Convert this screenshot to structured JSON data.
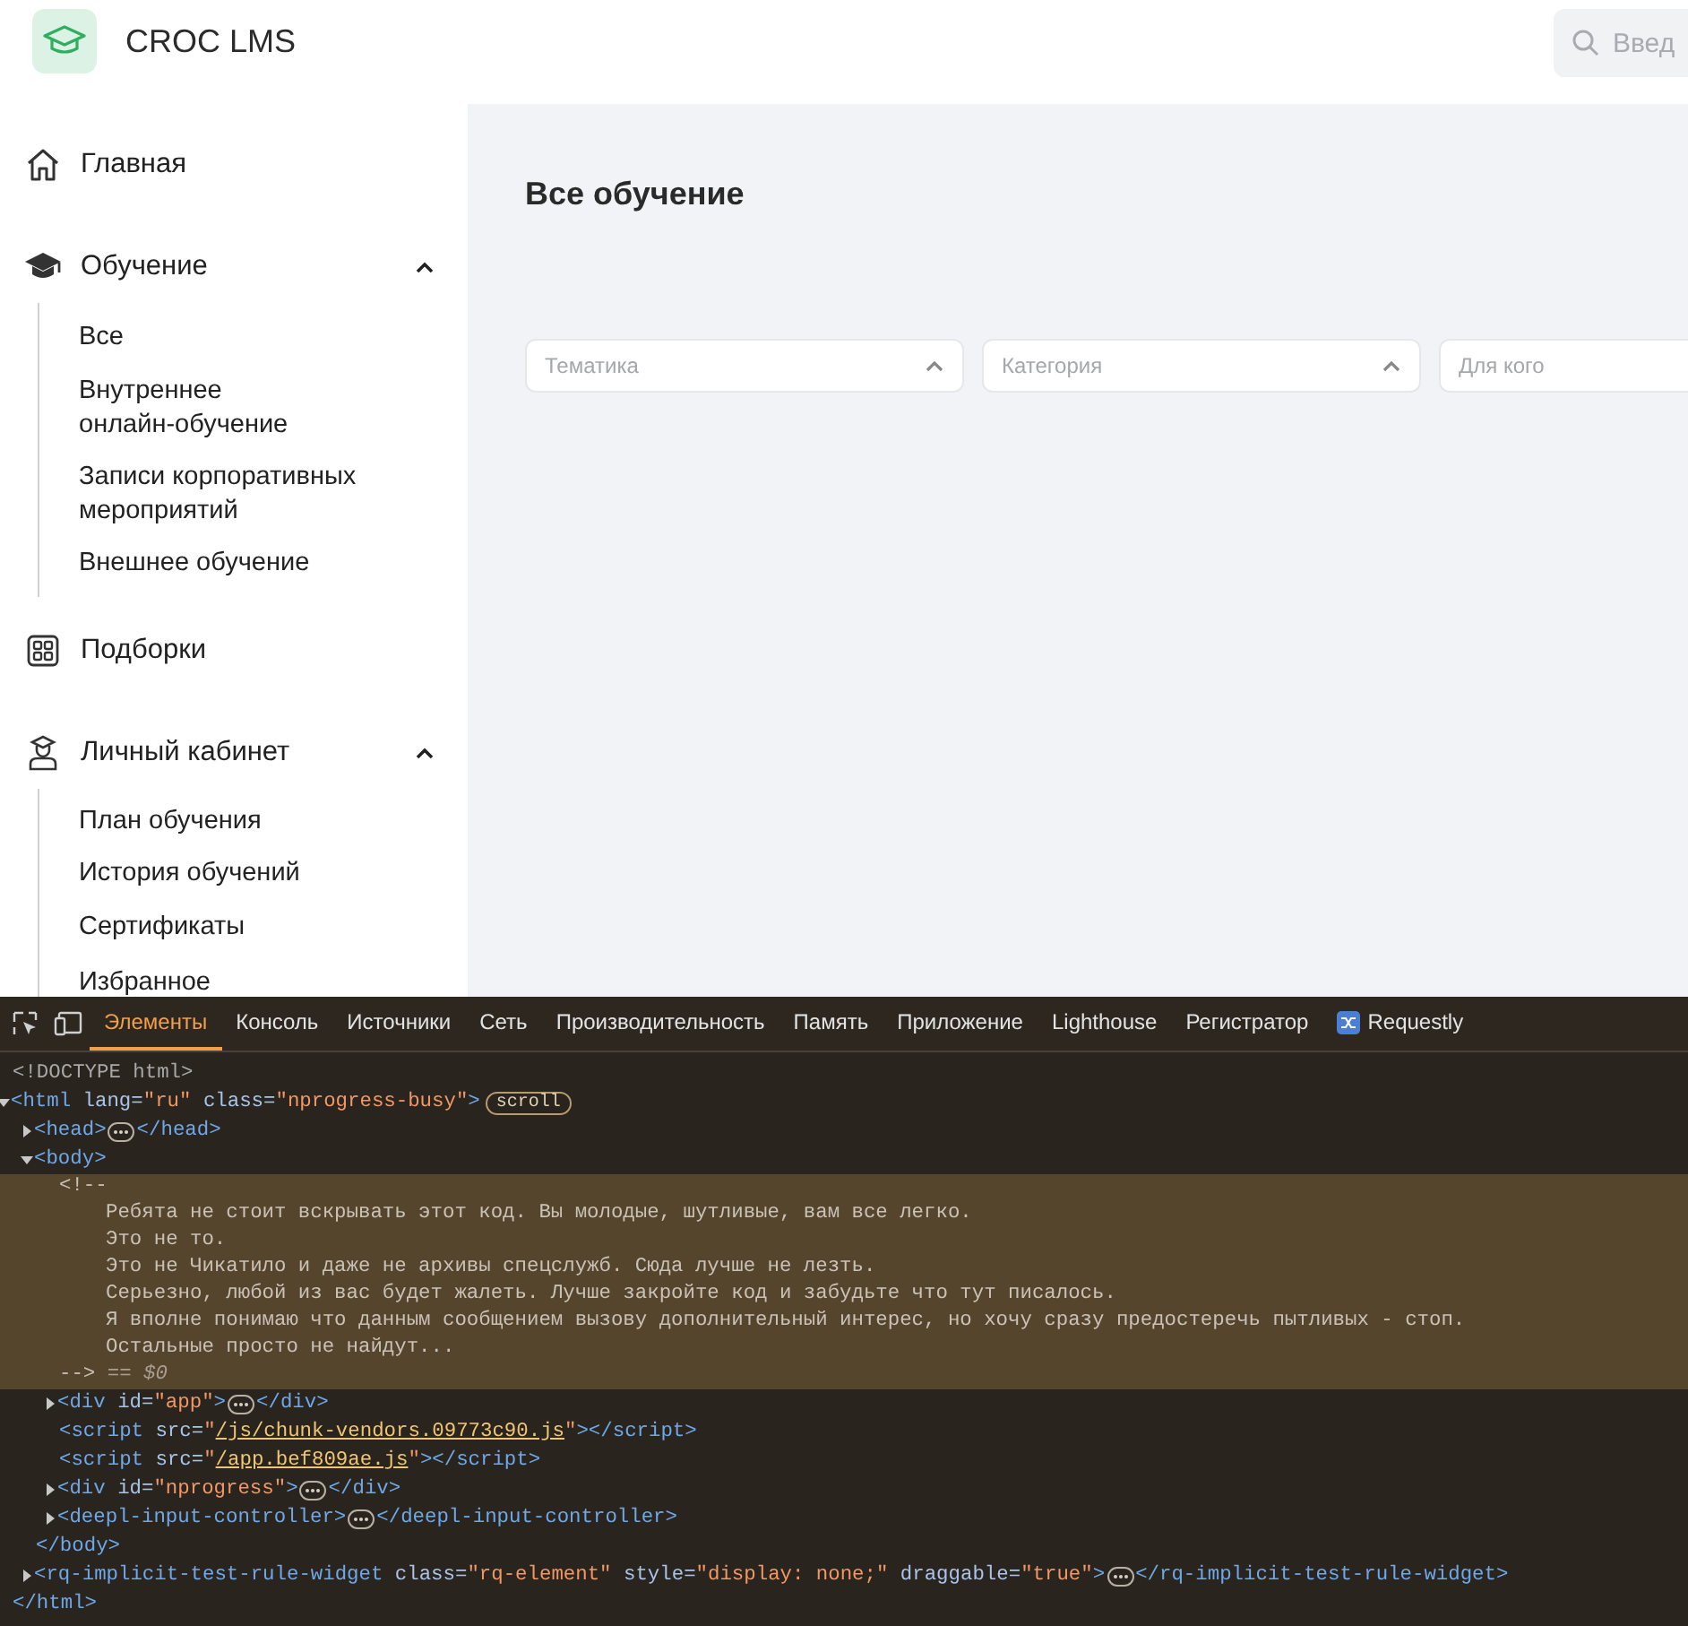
{
  "header": {
    "brand": "CROC LMS",
    "search": {
      "placeholder": "Введ"
    }
  },
  "sidebar": {
    "items": [
      {
        "kind": "link",
        "label": "Главная"
      },
      {
        "kind": "section",
        "label": "Обучение",
        "expanded": true,
        "children": [
          {
            "label": "Все"
          },
          {
            "label": "Внутреннее онлайн-обучение"
          },
          {
            "label": "Записи корпоративных мероприятий"
          },
          {
            "label": "Внешнее обучение"
          }
        ]
      },
      {
        "kind": "link",
        "label": "Подборки"
      },
      {
        "kind": "section",
        "label": "Личный кабинет",
        "expanded": true,
        "children": [
          {
            "label": "План обучения"
          },
          {
            "label": "История обучений"
          },
          {
            "label": "Сертификаты"
          },
          {
            "label": "Избранное"
          }
        ]
      }
    ]
  },
  "main": {
    "title": "Все обучение",
    "filters": [
      {
        "kind": "dropdown",
        "placeholder": "Тематика"
      },
      {
        "kind": "dropdown",
        "placeholder": "Категория"
      },
      {
        "kind": "cut",
        "placeholder": "Для кого"
      }
    ]
  },
  "devtools": {
    "tabs": [
      {
        "kind": "panel",
        "label": "Элементы",
        "selected": true
      },
      {
        "kind": "panel",
        "label": "Консоль",
        "selected": false
      },
      {
        "kind": "panel",
        "label": "Источники",
        "selected": false
      },
      {
        "kind": "panel",
        "label": "Сеть",
        "selected": false
      },
      {
        "kind": "panel",
        "label": "Производительность",
        "selected": false
      },
      {
        "kind": "panel",
        "label": "Память",
        "selected": false
      },
      {
        "kind": "panel",
        "label": "Приложение",
        "selected": false
      },
      {
        "kind": "panel",
        "label": "Lighthouse",
        "selected": false
      },
      {
        "kind": "panel",
        "label": "Регистратор",
        "selected": false
      },
      {
        "kind": "extension",
        "label": "Requestly",
        "selected": false
      }
    ],
    "tree": [
      {
        "kind": "line",
        "selected": false,
        "segments": [
          {
            "kind": "doctype",
            "text": "<!DOCTYPE html>"
          }
        ]
      },
      {
        "kind": "node",
        "expanded": true,
        "selected": false,
        "open": [
          {
            "kind": "tag",
            "text": "<html"
          },
          {
            "kind": "attr",
            "text": " lang="
          },
          {
            "kind": "value",
            "text": "\"ru\""
          },
          {
            "kind": "attr",
            "text": " class="
          },
          {
            "kind": "value",
            "text": "\"nprogress-busy\""
          },
          {
            "kind": "tag",
            "text": ">"
          },
          {
            "kind": "badge",
            "text": "scroll"
          }
        ],
        "close": [
          {
            "kind": "tag",
            "text": "</html>"
          }
        ],
        "children": [
          {
            "kind": "node",
            "expanded": false,
            "selected": false,
            "open": [
              {
                "kind": "tag",
                "text": "<head>"
              }
            ],
            "close": [
              {
                "kind": "tag",
                "text": "</head>"
              }
            ]
          },
          {
            "kind": "node",
            "expanded": true,
            "selected": false,
            "open": [
              {
                "kind": "tag",
                "text": "<body>"
              }
            ],
            "close": [
              {
                "kind": "tag",
                "text": "</body>"
              }
            ],
            "children": [
              {
                "kind": "comment",
                "selected": true,
                "open": "<!--",
                "lines": [
                  "Ребята не стоит вскрывать этот код. Вы молодые, шутливые, вам все легко.",
                  "Это не то.",
                  "Это не Чикатило и даже не архивы спецслужб. Сюда лучше не лезть.",
                  "Серьезно, любой из вас будет жалеть. Лучше закройте код и забудьте что тут писалось.",
                  "Я вполне понимаю что данным сообщением вызову дополнительный интерес, но хочу сразу предостеречь пытливых - стоп.",
                  "Остальные просто не найдут..."
                ],
                "close": "-->",
                "marker": "== $0"
              },
              {
                "kind": "node",
                "expanded": false,
                "selected": false,
                "open": [
                  {
                    "kind": "tag",
                    "text": "<div"
                  },
                  {
                    "kind": "attr",
                    "text": " id="
                  },
                  {
                    "kind": "value",
                    "text": "\"app\""
                  },
                  {
                    "kind": "tag",
                    "text": ">"
                  }
                ],
                "close": [
                  {
                    "kind": "tag",
                    "text": "</div>"
                  }
                ]
              },
              {
                "kind": "line",
                "selected": false,
                "segments": [
                  {
                    "kind": "tag",
                    "text": "<script"
                  },
                  {
                    "kind": "attr",
                    "text": " src="
                  },
                  {
                    "kind": "value",
                    "text": "\""
                  },
                  {
                    "kind": "link",
                    "text": "/js/chunk-vendors.09773c90.js"
                  },
                  {
                    "kind": "value",
                    "text": "\""
                  },
                  {
                    "kind": "tag",
                    "text": "></script>"
                  }
                ]
              },
              {
                "kind": "line",
                "selected": false,
                "segments": [
                  {
                    "kind": "tag",
                    "text": "<script"
                  },
                  {
                    "kind": "attr",
                    "text": " src="
                  },
                  {
                    "kind": "value",
                    "text": "\""
                  },
                  {
                    "kind": "link",
                    "text": "/app.bef809ae.js"
                  },
                  {
                    "kind": "value",
                    "text": "\""
                  },
                  {
                    "kind": "tag",
                    "text": "></script>"
                  }
                ]
              },
              {
                "kind": "node",
                "expanded": false,
                "selected": false,
                "open": [
                  {
                    "kind": "tag",
                    "text": "<div"
                  },
                  {
                    "kind": "attr",
                    "text": " id="
                  },
                  {
                    "kind": "value",
                    "text": "\"nprogress\""
                  },
                  {
                    "kind": "tag",
                    "text": ">"
                  }
                ],
                "close": [
                  {
                    "kind": "tag",
                    "text": "</div>"
                  }
                ]
              },
              {
                "kind": "node",
                "expanded": false,
                "selected": false,
                "open": [
                  {
                    "kind": "tag",
                    "text": "<deepl-input-controller>"
                  }
                ],
                "close": [
                  {
                    "kind": "tag",
                    "text": "</deepl-input-controller>"
                  }
                ]
              }
            ]
          },
          {
            "kind": "node",
            "expanded": false,
            "selected": false,
            "open": [
              {
                "kind": "tag",
                "text": "<rq-implicit-test-rule-widget"
              },
              {
                "kind": "attr",
                "text": " class="
              },
              {
                "kind": "value",
                "text": "\"rq-element\""
              },
              {
                "kind": "attr",
                "text": " style="
              },
              {
                "kind": "value",
                "text": "\"display: none;\""
              },
              {
                "kind": "attr",
                "text": " draggable="
              },
              {
                "kind": "value",
                "text": "\"true\""
              },
              {
                "kind": "tag",
                "text": ">"
              }
            ],
            "close": [
              {
                "kind": "tag",
                "text": "</rq-implicit-test-rule-widget>"
              }
            ]
          }
        ]
      }
    ]
  }
}
